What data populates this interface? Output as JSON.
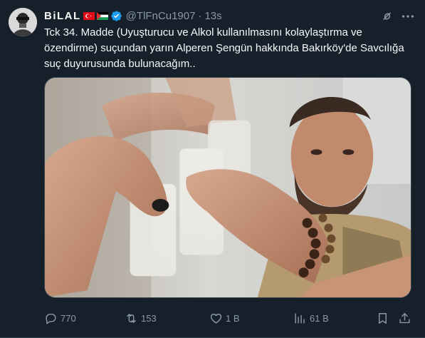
{
  "tweet": {
    "display_name": "BiLAL",
    "handle": "@TlFnCu1907",
    "separator": "·",
    "time": "13s",
    "text": "Tck 34. Madde (Uyuşturucu ve Alkol kullanılmasını kolaylaştırma ve özendirme) suçundan yarın Alperen Şengün hakkında Bakırköy'de Savcılığa suç duyurusunda bulunacağım..",
    "badges": [
      "turkey-flag",
      "palestine-flag",
      "verified-badge"
    ],
    "icons": {
      "grok": "grok-icon",
      "more": "more-icon"
    }
  },
  "actions": {
    "reply": {
      "icon": "reply-icon",
      "count": "770"
    },
    "retweet": {
      "icon": "retweet-icon",
      "count": "153"
    },
    "like": {
      "icon": "heart-icon",
      "count": "1 B"
    },
    "views": {
      "icon": "views-icon",
      "count": "61 B"
    },
    "bookmark": {
      "icon": "bookmark-icon"
    },
    "share": {
      "icon": "share-icon"
    }
  },
  "colors": {
    "background": "#15202b",
    "text": "#f7f9f9",
    "secondary": "#8b98a5",
    "verified": "#1d9bf0",
    "border": "#38444d"
  }
}
